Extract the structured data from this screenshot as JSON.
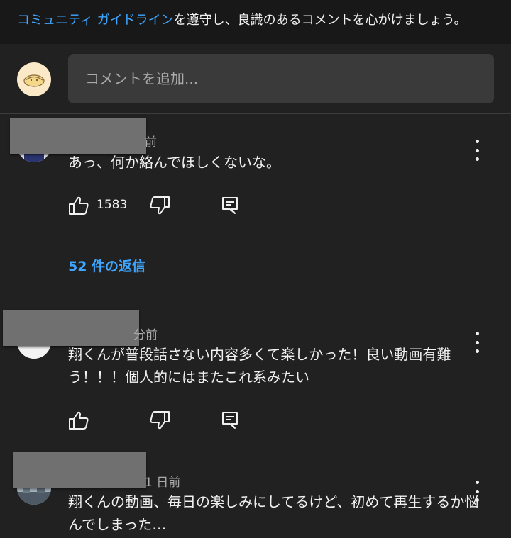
{
  "guideline": {
    "link_text": "コミュニティ ガイドライン",
    "rest_text": "を遵守し、良識のあるコメントを心がけましょう。"
  },
  "composer": {
    "placeholder": "コメントを追加..."
  },
  "comments": [
    {
      "time_fragment": "前",
      "text": "あっ、何か絡んでほしくないな。",
      "like_count": "1583",
      "replies_label": "52 件の返信"
    },
    {
      "time_fragment": "分前",
      "text": "翔くんが普段話さない内容多くて楽しかった！良い動画有難う！！！個人的にはまたこれ系みたい",
      "like_count": ""
    },
    {
      "time_fragment": "1 日前",
      "text": "翔くんの動画、毎日の楽しみにしてるけど、初めて再生するか悩んでしまった…"
    }
  ],
  "icons": {
    "like": "thumb-up-icon",
    "dislike": "thumb-down-icon",
    "reply": "reply-icon",
    "more": "more-vert-icon"
  },
  "colors": {
    "background": "#212121",
    "link": "#3ea6ff",
    "muted": "#aaaaaa"
  }
}
